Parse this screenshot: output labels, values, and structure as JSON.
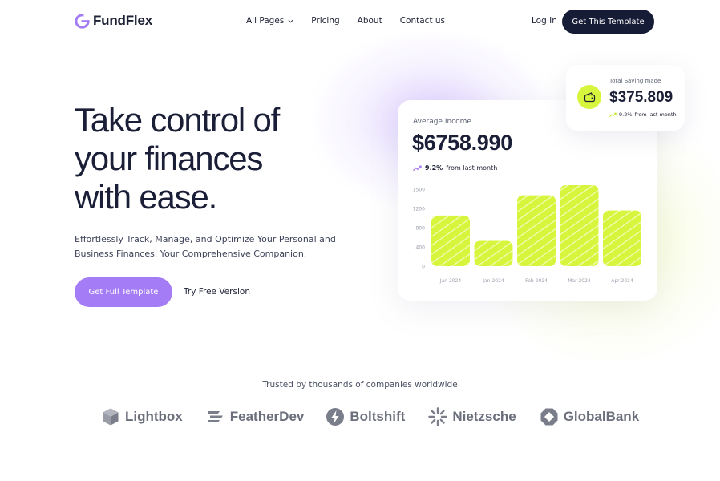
{
  "nav": {
    "logo_text": "FundFlex",
    "links": [
      "All Pages",
      "Pricing",
      "About",
      "Contact us"
    ],
    "login": "Log In",
    "cta": "Get This Template"
  },
  "hero": {
    "title_lines": [
      "Take control of",
      "your finances",
      "with ease."
    ],
    "subtitle_lines": [
      "Effortlessly Track, Manage, and Optimize Your Personal and",
      "Business Finances. Your Comprehensive Companion."
    ],
    "primary_button": "Get Full Template",
    "secondary_button": "Try Free Version"
  },
  "income_card": {
    "label": "Average Income",
    "value": "$6758.990",
    "change_pct": "9.2%",
    "change_text": "from last month"
  },
  "saving_card": {
    "label": "Total Saving made",
    "value": "$375.809",
    "change_pct": "9.2%",
    "change_text": "from last month"
  },
  "chart_data": {
    "type": "bar",
    "categories": [
      "Jan 2024",
      "Jan 2024",
      "Feb 2024",
      "Mar 2024",
      "Apr 2024"
    ],
    "values": [
      1000,
      500,
      1400,
      1600,
      1100
    ],
    "y_ticks": [
      "0",
      "400",
      "800",
      "1200",
      "1500"
    ],
    "ylim": [
      0,
      1600
    ],
    "bar_color": "#d7f53c",
    "grid": false
  },
  "trusted": {
    "text": "Trusted by thousands of companies worldwide",
    "logos": [
      {
        "name": "Lightbox",
        "icon": "cube-icon"
      },
      {
        "name": "FeatherDev",
        "icon": "feather-lines-icon"
      },
      {
        "name": "Boltshift",
        "icon": "bolt-icon"
      },
      {
        "name": "Nietzsche",
        "icon": "sunburst-icon"
      },
      {
        "name": "GlobalBank",
        "icon": "octagon-icon"
      }
    ]
  },
  "colors": {
    "accent_purple": "#a47cf5",
    "accent_green": "#d7f53c",
    "dark": "#161b36"
  }
}
